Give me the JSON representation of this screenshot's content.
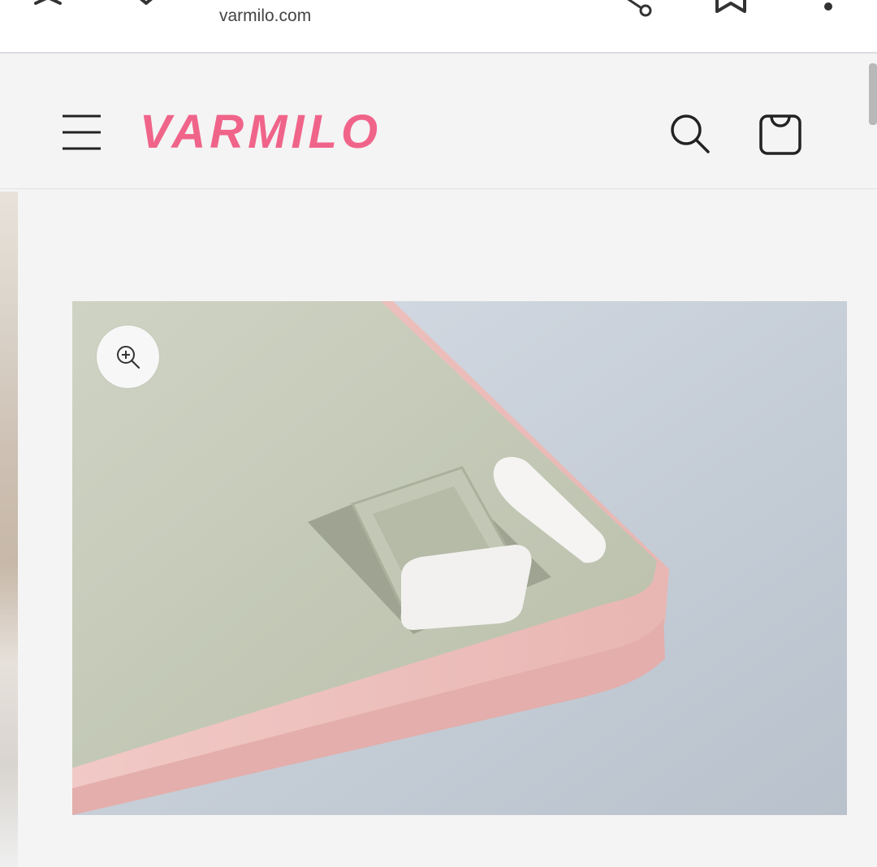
{
  "browser": {
    "url": "varmilo.com",
    "icons": [
      "close-icon",
      "chevron-down-icon",
      "share-icon",
      "bookmark-icon",
      "more-vert-icon"
    ]
  },
  "header": {
    "logo": "VARMILO",
    "brand_color": "#f0648a",
    "icons": [
      "menu-icon",
      "search-icon",
      "cart-icon"
    ]
  },
  "product": {
    "image_description_icons": [
      "zoom-in-icon"
    ]
  }
}
